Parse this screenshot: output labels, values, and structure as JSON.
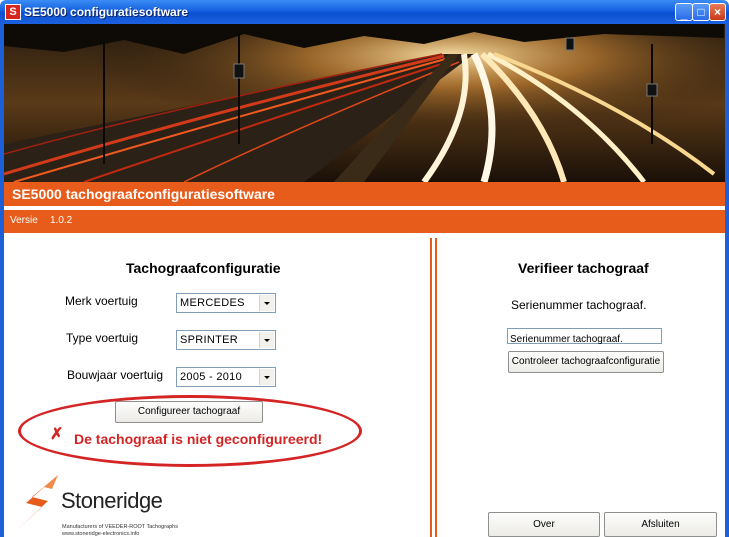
{
  "window": {
    "title": "SE5000 configuratiesoftware",
    "icon_letter": "S"
  },
  "app": {
    "header": "SE5000 tachograafconfiguratiesoftware",
    "version_label": "Versie",
    "version": "1.0.2"
  },
  "config": {
    "title": "Tachograafconfiguratie",
    "fields": [
      {
        "label": "Merk voertuig",
        "value": "MERCEDES"
      },
      {
        "label": "Type voertuig",
        "value": "SPRINTER"
      },
      {
        "label": "Bouwjaar voertuig",
        "value": "2005 - 2010"
      }
    ],
    "configure_button": "Configureer tachograaf",
    "error_message": "De tachograaf is niet geconfigureerd!",
    "error_mark": "✗"
  },
  "verify": {
    "title": "Verifieer tachograaf",
    "serial_label": "Serienummer tachograaf.",
    "serial_placeholder": "Serienummer tachograaf.",
    "check_button": "Controleer tachograafconfiguratie"
  },
  "footer": {
    "about_button": "Over",
    "close_button": "Afsluiten"
  },
  "logo": {
    "name": "Stoneridge",
    "tagline1": "Manufacturers of VEEDER-ROOT Tachographs",
    "tagline2": "www.stoneridge-electronics.info"
  },
  "colors": {
    "accent": "#e85c1b",
    "error": "#d42424",
    "titlebar": "#1560e0"
  }
}
